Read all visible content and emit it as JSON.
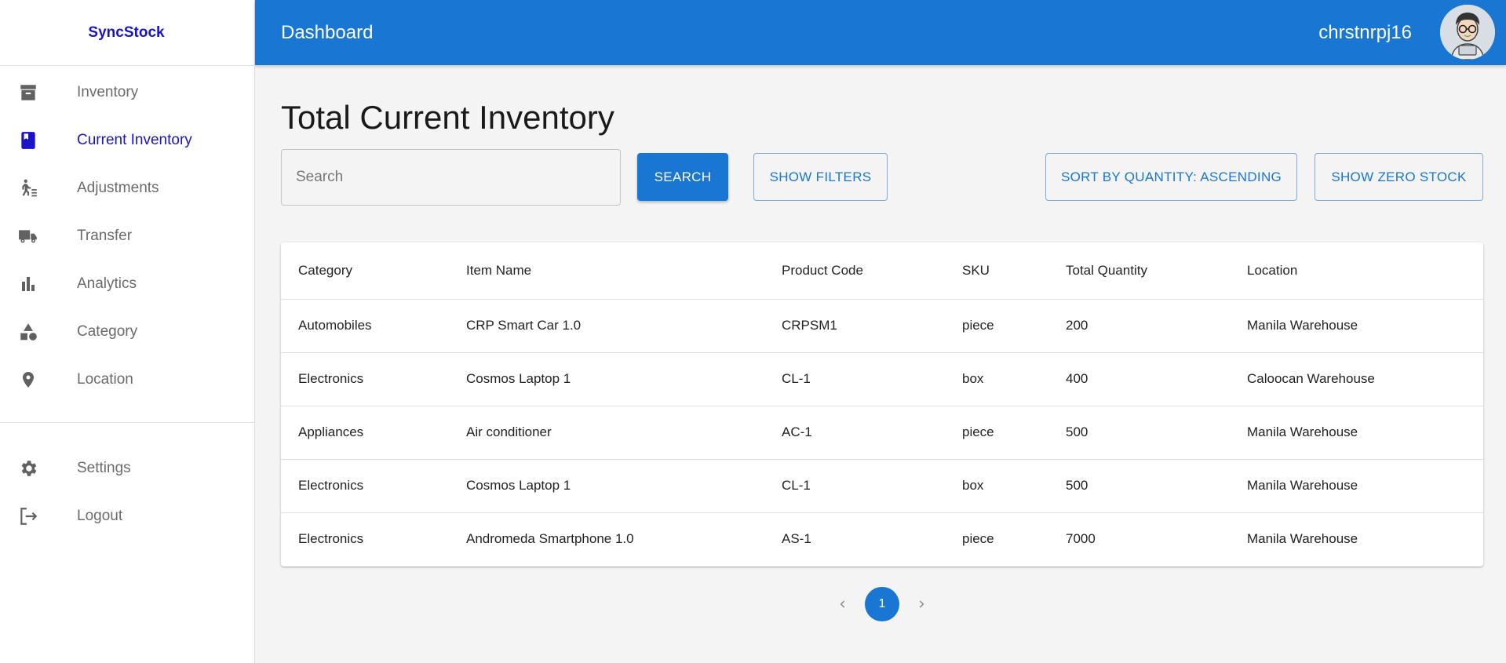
{
  "app": {
    "brand": "SyncStock"
  },
  "sidebar": {
    "items": [
      {
        "label": "Inventory",
        "icon": "archive-icon",
        "active": false
      },
      {
        "label": "Current Inventory",
        "icon": "book-icon",
        "active": true
      },
      {
        "label": "Adjustments",
        "icon": "person-adjust-icon",
        "active": false
      },
      {
        "label": "Transfer",
        "icon": "truck-icon",
        "active": false
      },
      {
        "label": "Analytics",
        "icon": "bar-chart-icon",
        "active": false
      },
      {
        "label": "Category",
        "icon": "shapes-icon",
        "active": false
      },
      {
        "label": "Location",
        "icon": "location-pin-icon",
        "active": false
      }
    ],
    "bottom_items": [
      {
        "label": "Settings",
        "icon": "gear-icon"
      },
      {
        "label": "Logout",
        "icon": "logout-icon"
      }
    ]
  },
  "header": {
    "title": "Dashboard",
    "username": "chrstnrpj16"
  },
  "main": {
    "title": "Total Current Inventory",
    "search": {
      "placeholder": "Search",
      "value": ""
    },
    "buttons": {
      "search": "SEARCH",
      "filters": "SHOW FILTERS",
      "sort": "SORT BY QUANTITY: ASCENDING",
      "zero_stock": "SHOW ZERO STOCK"
    },
    "table": {
      "columns": [
        "Category",
        "Item Name",
        "Product Code",
        "SKU",
        "Total Quantity",
        "Location"
      ],
      "rows": [
        [
          "Automobiles",
          "CRP Smart Car 1.0",
          "CRPSM1",
          "piece",
          "200",
          "Manila Warehouse"
        ],
        [
          "Electronics",
          "Cosmos Laptop 1",
          "CL-1",
          "box",
          "400",
          "Caloocan Warehouse"
        ],
        [
          "Appliances",
          "Air conditioner",
          "AC-1",
          "piece",
          "500",
          "Manila Warehouse"
        ],
        [
          "Electronics",
          "Cosmos Laptop 1",
          "CL-1",
          "box",
          "500",
          "Manila Warehouse"
        ],
        [
          "Electronics",
          "Andromeda Smartphone 1.0",
          "AS-1",
          "piece",
          "7000",
          "Manila Warehouse"
        ]
      ]
    },
    "pagination": {
      "current": "1"
    }
  },
  "colors": {
    "primary": "#1976d2",
    "brand": "#1a14c9",
    "sidebar_text": "#6b6b6b",
    "icon": "#616161"
  }
}
